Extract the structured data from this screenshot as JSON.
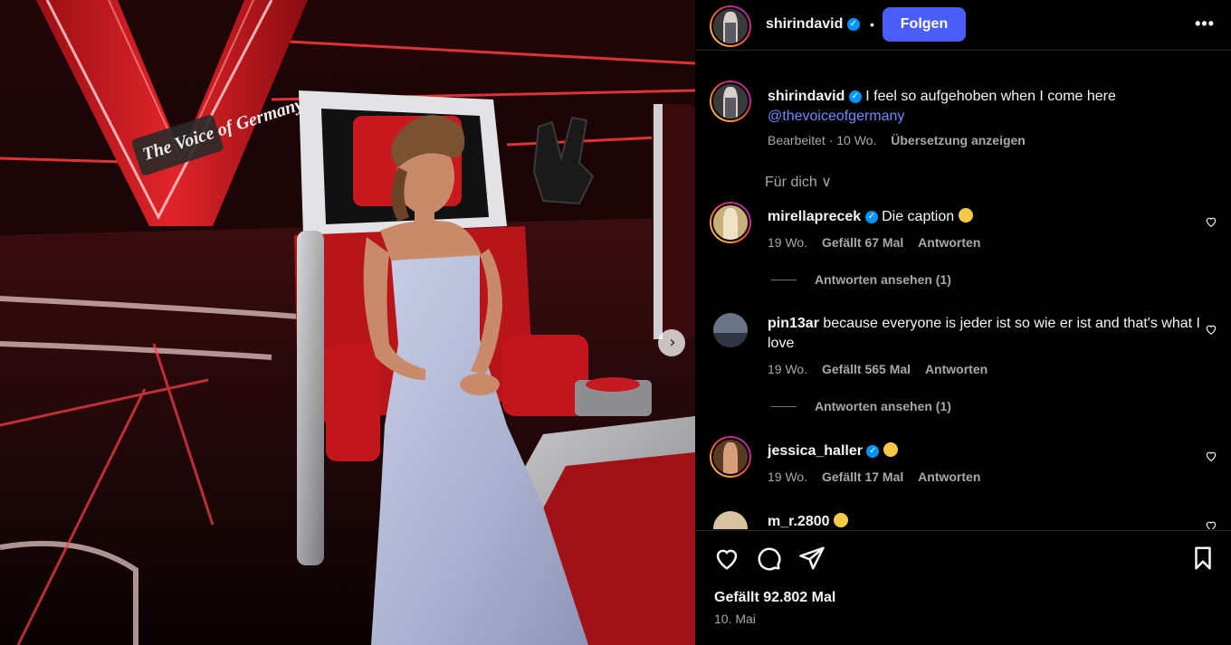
{
  "post": {
    "author": "shirindavid",
    "separator": "•",
    "follow_label": "Folgen",
    "more_label": "•••",
    "caption": "I feel so aufgehoben when I come here",
    "mention": "@thevoiceofgermany",
    "edited_label": "Bearbeitet · 10 Wo.",
    "translate_label": "Übersetzung anzeigen",
    "sort_label": "Für dich ∨",
    "media_logo": "The Voice of Germany",
    "next_label": "›"
  },
  "comments": [
    {
      "user": "mirellaprecek",
      "verified": true,
      "text": "Die caption",
      "emoji": "grimace",
      "time": "19 Wo.",
      "likes": "Gefällt 67 Mal",
      "reply": "Antworten",
      "view_replies": "Antworten ansehen (1)"
    },
    {
      "user": "pin13ar",
      "verified": false,
      "text": "because everyone is jeder ist so wie er ist and that's what I love",
      "time": "19 Wo.",
      "likes": "Gefällt 565 Mal",
      "reply": "Antworten",
      "view_replies": "Antworten ansehen (1)"
    },
    {
      "user": "jessica_haller",
      "verified": true,
      "text": "",
      "emoji": "heart-eyes",
      "time": "19 Wo.",
      "likes": "Gefällt 17 Mal",
      "reply": "Antworten"
    },
    {
      "user": "m_r.2800",
      "verified": false,
      "text": "",
      "emoji": "heart-eyes"
    }
  ],
  "footer": {
    "likes_label": "Gefällt 92.802 Mal",
    "date_label": "10. Mai"
  },
  "colors": {
    "accent": "#4a5df9",
    "verified": "#0095f6",
    "mention": "#6d8bff"
  }
}
